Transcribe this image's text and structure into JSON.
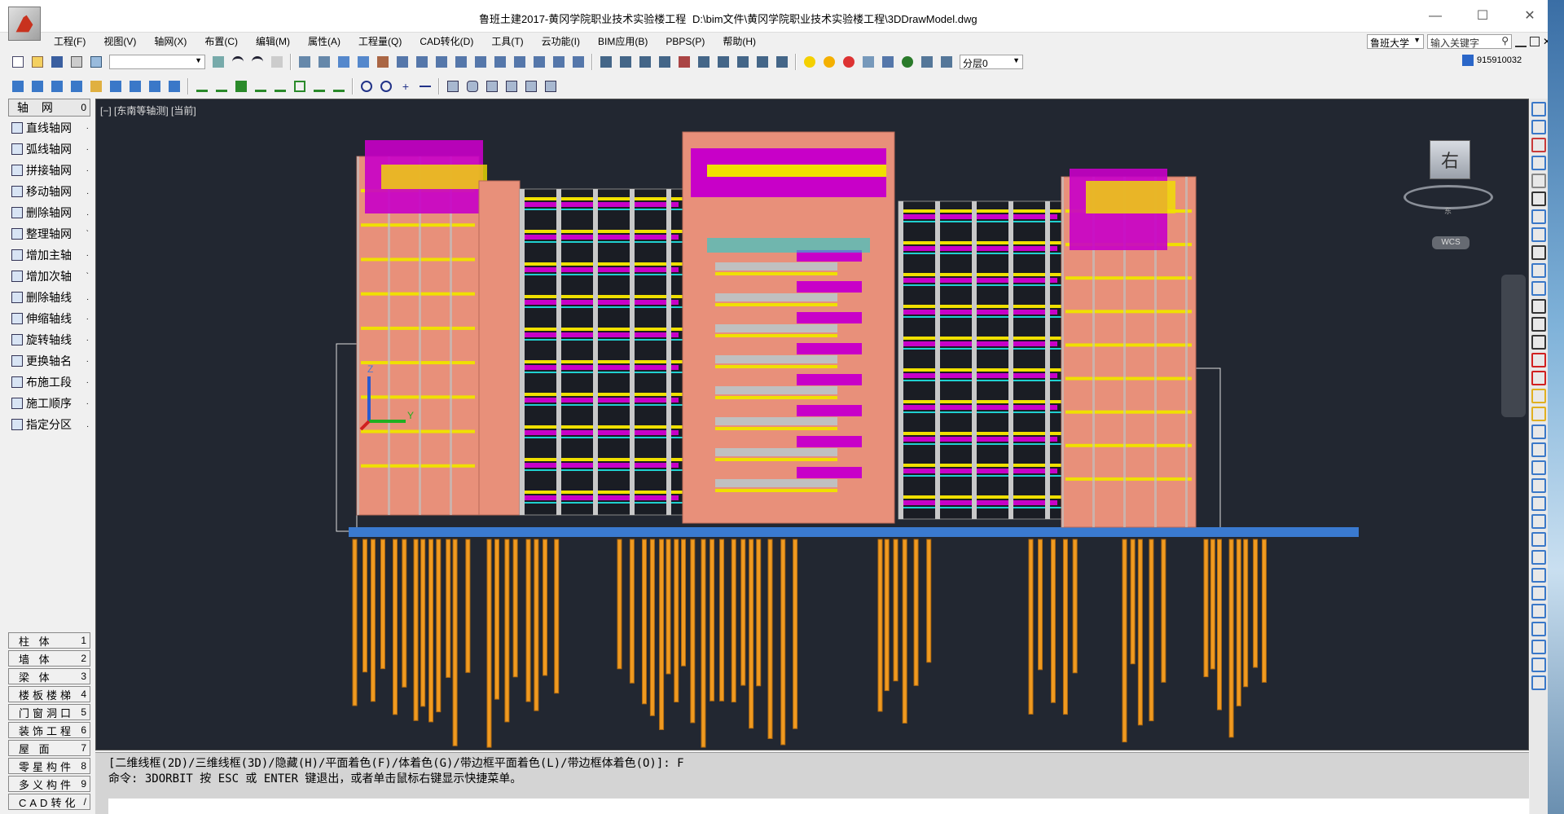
{
  "titlebar": {
    "app_title": "鲁班土建2017-黄冈学院职业技术实验楼工程",
    "file_path": "D:\\bim文件\\黄冈学院职业技术实验楼工程\\3DDrawModel.dwg",
    "minimize_glyph": "—",
    "maximize_glyph": "☐",
    "close_glyph": "✕"
  },
  "menubar": {
    "items": [
      "工程(F)",
      "视图(V)",
      "轴网(X)",
      "布置(C)",
      "编辑(M)",
      "属性(A)",
      "工程量(Q)",
      "CAD转化(D)",
      "工具(T)",
      "云功能(I)",
      "BIM应用(B)",
      "PBPS(P)",
      "帮助(H)"
    ]
  },
  "right_menu": {
    "org_select": "鲁班大学",
    "keyword_placeholder": "输入关键字",
    "user_id": "915910032"
  },
  "toolbar": {
    "layer_select": "分层0",
    "blank_select": ""
  },
  "sidebar": {
    "header_label": "轴 网",
    "header_key": "0",
    "items": [
      {
        "label": "直线轴网",
        "key": "·"
      },
      {
        "label": "弧线轴网",
        "key": "·"
      },
      {
        "label": "拼接轴网",
        "key": "·"
      },
      {
        "label": "移动轴网",
        "key": "."
      },
      {
        "label": "删除轴网",
        "key": "."
      },
      {
        "label": "整理轴网",
        "key": "`"
      },
      {
        "label": "增加主轴",
        "key": "·"
      },
      {
        "label": "增加次轴",
        "key": "`"
      },
      {
        "label": "删除轴线",
        "key": "."
      },
      {
        "label": "伸缩轴线",
        "key": "·"
      },
      {
        "label": "旋转轴线",
        "key": "·"
      },
      {
        "label": "更换轴名",
        "key": "·"
      },
      {
        "label": "布施工段",
        "key": "·"
      },
      {
        "label": "施工顺序",
        "key": "·"
      },
      {
        "label": "指定分区",
        "key": "."
      }
    ],
    "categories": [
      {
        "label": "柱 体",
        "key": "1"
      },
      {
        "label": "墙 体",
        "key": "2"
      },
      {
        "label": "梁 体",
        "key": "3"
      },
      {
        "label": "楼板楼梯",
        "key": "4"
      },
      {
        "label": "门窗洞口",
        "key": "5"
      },
      {
        "label": "装饰工程",
        "key": "6"
      },
      {
        "label": "屋 面",
        "key": "7"
      },
      {
        "label": "零星构件",
        "key": "8"
      },
      {
        "label": "多义构件",
        "key": "9"
      },
      {
        "label": "CAD转化",
        "key": "/"
      }
    ]
  },
  "viewport": {
    "label": "[−] [东南等轴测] [当前]",
    "viewcube_face": "右",
    "viewcube_compass": "东",
    "wcs_label": "WCS",
    "axis_z": "Z",
    "axis_y": "Y"
  },
  "command": {
    "line1": "[二维线框(2D)/三维线框(3D)/隐藏(H)/平面着色(F)/体着色(G)/带边框平面着色(L)/带边框体着色(O)]: F",
    "line2": "命令: 3DORBIT 按 ESC 或 ENTER 键退出，或者单击鼠标右键显示快捷菜单。"
  },
  "colors": {
    "viewport_bg": "#222731",
    "facade": "#e8907a",
    "slab_magenta": "#c800c8",
    "beam_yellow": "#f0e000",
    "pile_orange": "#f09a20",
    "rail_cyan": "#20d0d0"
  }
}
